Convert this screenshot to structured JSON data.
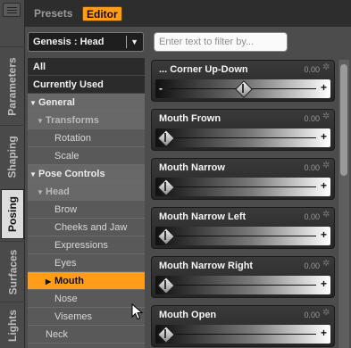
{
  "left_tabs": [
    "Parameters",
    "Shaping",
    "Posing",
    "Surfaces",
    "Lights"
  ],
  "active_left_tab": "Posing",
  "top_tabs": {
    "presets": "Presets",
    "editor": "Editor"
  },
  "figure_select": {
    "value": "Genesis : Head"
  },
  "filter": {
    "placeholder": "Enter text to filter by..."
  },
  "tree": [
    {
      "label": "All"
    },
    {
      "label": "Currently Used"
    },
    {
      "label": "General",
      "expanded": true
    },
    {
      "label": "Transforms",
      "expanded": true
    },
    {
      "label": "Rotation"
    },
    {
      "label": "Scale"
    },
    {
      "label": "Pose Controls",
      "expanded": true
    },
    {
      "label": "Head",
      "expanded": true
    },
    {
      "label": "Brow"
    },
    {
      "label": "Cheeks and Jaw"
    },
    {
      "label": "Expressions"
    },
    {
      "label": "Eyes"
    },
    {
      "label": "Mouth",
      "selected": true
    },
    {
      "label": "Nose"
    },
    {
      "label": "Visemes"
    },
    {
      "label": "Neck"
    }
  ],
  "sliders": [
    {
      "label": "... Corner Up-Down",
      "value": "0.00",
      "level": 0.5
    },
    {
      "label": "Mouth Frown",
      "value": "0.00",
      "level": 0
    },
    {
      "label": "Mouth Narrow",
      "value": "0.00",
      "level": 0
    },
    {
      "label": "Mouth Narrow Left",
      "value": "0.00",
      "level": 0
    },
    {
      "label": "Mouth Narrow Right",
      "value": "0.00",
      "level": 0
    },
    {
      "label": "Mouth Open",
      "value": "0.00",
      "level": 0
    }
  ],
  "colors": {
    "accent": "#ff9c1a",
    "panel": "#4c4c4c",
    "tree_dark": "#2b2b2b"
  }
}
